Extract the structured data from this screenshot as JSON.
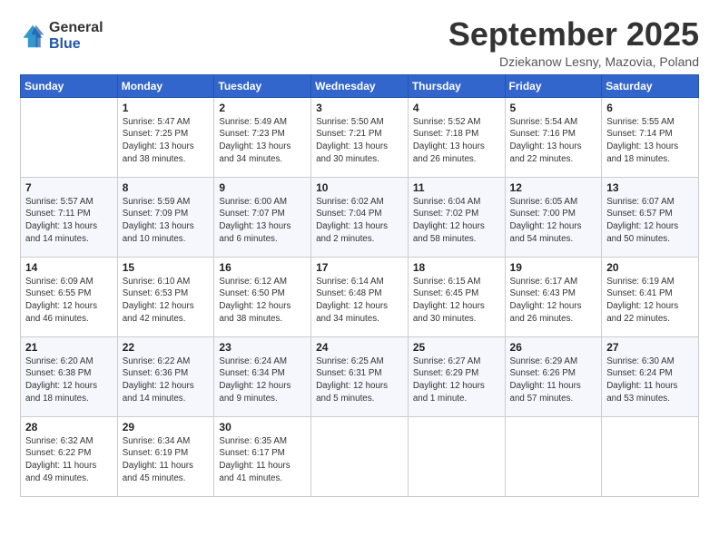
{
  "logo": {
    "general": "General",
    "blue": "Blue"
  },
  "header": {
    "month": "September 2025",
    "location": "Dziekanow Lesny, Mazovia, Poland"
  },
  "weekdays": [
    "Sunday",
    "Monday",
    "Tuesday",
    "Wednesday",
    "Thursday",
    "Friday",
    "Saturday"
  ],
  "weeks": [
    [
      {
        "day": "",
        "info": ""
      },
      {
        "day": "1",
        "info": "Sunrise: 5:47 AM\nSunset: 7:25 PM\nDaylight: 13 hours\nand 38 minutes."
      },
      {
        "day": "2",
        "info": "Sunrise: 5:49 AM\nSunset: 7:23 PM\nDaylight: 13 hours\nand 34 minutes."
      },
      {
        "day": "3",
        "info": "Sunrise: 5:50 AM\nSunset: 7:21 PM\nDaylight: 13 hours\nand 30 minutes."
      },
      {
        "day": "4",
        "info": "Sunrise: 5:52 AM\nSunset: 7:18 PM\nDaylight: 13 hours\nand 26 minutes."
      },
      {
        "day": "5",
        "info": "Sunrise: 5:54 AM\nSunset: 7:16 PM\nDaylight: 13 hours\nand 22 minutes."
      },
      {
        "day": "6",
        "info": "Sunrise: 5:55 AM\nSunset: 7:14 PM\nDaylight: 13 hours\nand 18 minutes."
      }
    ],
    [
      {
        "day": "7",
        "info": "Sunrise: 5:57 AM\nSunset: 7:11 PM\nDaylight: 13 hours\nand 14 minutes."
      },
      {
        "day": "8",
        "info": "Sunrise: 5:59 AM\nSunset: 7:09 PM\nDaylight: 13 hours\nand 10 minutes."
      },
      {
        "day": "9",
        "info": "Sunrise: 6:00 AM\nSunset: 7:07 PM\nDaylight: 13 hours\nand 6 minutes."
      },
      {
        "day": "10",
        "info": "Sunrise: 6:02 AM\nSunset: 7:04 PM\nDaylight: 13 hours\nand 2 minutes."
      },
      {
        "day": "11",
        "info": "Sunrise: 6:04 AM\nSunset: 7:02 PM\nDaylight: 12 hours\nand 58 minutes."
      },
      {
        "day": "12",
        "info": "Sunrise: 6:05 AM\nSunset: 7:00 PM\nDaylight: 12 hours\nand 54 minutes."
      },
      {
        "day": "13",
        "info": "Sunrise: 6:07 AM\nSunset: 6:57 PM\nDaylight: 12 hours\nand 50 minutes."
      }
    ],
    [
      {
        "day": "14",
        "info": "Sunrise: 6:09 AM\nSunset: 6:55 PM\nDaylight: 12 hours\nand 46 minutes."
      },
      {
        "day": "15",
        "info": "Sunrise: 6:10 AM\nSunset: 6:53 PM\nDaylight: 12 hours\nand 42 minutes."
      },
      {
        "day": "16",
        "info": "Sunrise: 6:12 AM\nSunset: 6:50 PM\nDaylight: 12 hours\nand 38 minutes."
      },
      {
        "day": "17",
        "info": "Sunrise: 6:14 AM\nSunset: 6:48 PM\nDaylight: 12 hours\nand 34 minutes."
      },
      {
        "day": "18",
        "info": "Sunrise: 6:15 AM\nSunset: 6:45 PM\nDaylight: 12 hours\nand 30 minutes."
      },
      {
        "day": "19",
        "info": "Sunrise: 6:17 AM\nSunset: 6:43 PM\nDaylight: 12 hours\nand 26 minutes."
      },
      {
        "day": "20",
        "info": "Sunrise: 6:19 AM\nSunset: 6:41 PM\nDaylight: 12 hours\nand 22 minutes."
      }
    ],
    [
      {
        "day": "21",
        "info": "Sunrise: 6:20 AM\nSunset: 6:38 PM\nDaylight: 12 hours\nand 18 minutes."
      },
      {
        "day": "22",
        "info": "Sunrise: 6:22 AM\nSunset: 6:36 PM\nDaylight: 12 hours\nand 14 minutes."
      },
      {
        "day": "23",
        "info": "Sunrise: 6:24 AM\nSunset: 6:34 PM\nDaylight: 12 hours\nand 9 minutes."
      },
      {
        "day": "24",
        "info": "Sunrise: 6:25 AM\nSunset: 6:31 PM\nDaylight: 12 hours\nand 5 minutes."
      },
      {
        "day": "25",
        "info": "Sunrise: 6:27 AM\nSunset: 6:29 PM\nDaylight: 12 hours\nand 1 minute."
      },
      {
        "day": "26",
        "info": "Sunrise: 6:29 AM\nSunset: 6:26 PM\nDaylight: 11 hours\nand 57 minutes."
      },
      {
        "day": "27",
        "info": "Sunrise: 6:30 AM\nSunset: 6:24 PM\nDaylight: 11 hours\nand 53 minutes."
      }
    ],
    [
      {
        "day": "28",
        "info": "Sunrise: 6:32 AM\nSunset: 6:22 PM\nDaylight: 11 hours\nand 49 minutes."
      },
      {
        "day": "29",
        "info": "Sunrise: 6:34 AM\nSunset: 6:19 PM\nDaylight: 11 hours\nand 45 minutes."
      },
      {
        "day": "30",
        "info": "Sunrise: 6:35 AM\nSunset: 6:17 PM\nDaylight: 11 hours\nand 41 minutes."
      },
      {
        "day": "",
        "info": ""
      },
      {
        "day": "",
        "info": ""
      },
      {
        "day": "",
        "info": ""
      },
      {
        "day": "",
        "info": ""
      }
    ]
  ]
}
